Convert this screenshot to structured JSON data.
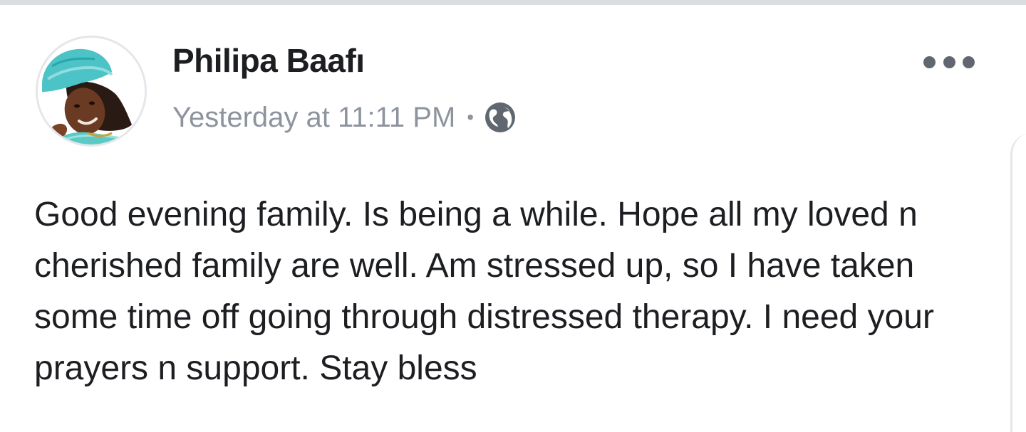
{
  "post": {
    "author": "Philipa Baafı",
    "timestamp": "Yesterday at 11:11 PM",
    "separator": "•",
    "privacy_icon": "globe-icon",
    "more_icon": "more-dots-icon",
    "avatar_icon": "profile-photo",
    "text": "Good evening family. Is being a while. Hope all my loved n cherished family are well. Am stressed up, so I have taken some time off going through distressed therapy. I need your prayers n support. Stay bless"
  },
  "colors": {
    "author": "#1c1e21",
    "meta": "#8d949e",
    "body_text": "#1c1e21",
    "icon": "#606770",
    "divider": "#dadde1"
  }
}
